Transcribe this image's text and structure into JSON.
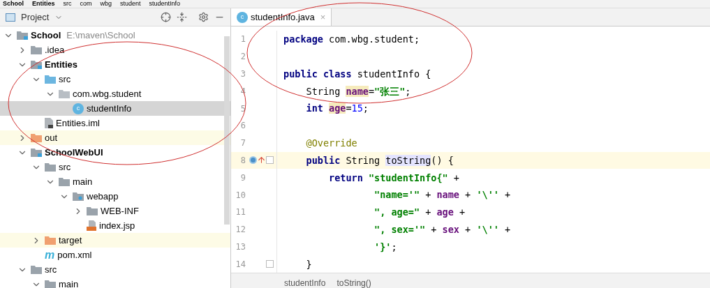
{
  "breadcrumbs": [
    "School",
    "Entities",
    "src",
    "com",
    "wbg",
    "student",
    "studentInfo"
  ],
  "project_panel": {
    "title": "Project",
    "tree": [
      {
        "label": "School",
        "path": "E:\\maven\\School",
        "kind": "module",
        "expanded": true,
        "selected": false,
        "children": [
          {
            "label": ".idea",
            "kind": "folder",
            "expanded": false,
            "selected": false
          },
          {
            "label": "Entities",
            "kind": "module",
            "expanded": true,
            "selected": false,
            "children": [
              {
                "label": "src",
                "kind": "source",
                "expanded": true,
                "selected": false,
                "children": [
                  {
                    "label": "com.wbg.student",
                    "kind": "package",
                    "expanded": true,
                    "selected": false,
                    "children": [
                      {
                        "label": "studentInfo",
                        "kind": "class",
                        "icon": "c",
                        "selected": true
                      }
                    ]
                  }
                ]
              },
              {
                "label": "Entities.iml",
                "kind": "iml",
                "selected": false
              }
            ]
          },
          {
            "label": "out",
            "kind": "excluded",
            "expanded": false,
            "selected": false
          },
          {
            "label": "SchoolWebUI",
            "kind": "module",
            "expanded": true,
            "selected": false,
            "children": [
              {
                "label": "src",
                "kind": "folder",
                "expanded": true,
                "selected": false,
                "children": [
                  {
                    "label": "main",
                    "kind": "folder",
                    "expanded": true,
                    "selected": false,
                    "children": [
                      {
                        "label": "webapp",
                        "kind": "web",
                        "expanded": true,
                        "selected": false,
                        "children": [
                          {
                            "label": "WEB-INF",
                            "kind": "folder",
                            "expanded": false,
                            "selected": false
                          },
                          {
                            "label": "index.jsp",
                            "kind": "jsp",
                            "selected": false
                          }
                        ]
                      }
                    ]
                  }
                ]
              },
              {
                "label": "target",
                "kind": "excluded",
                "expanded": false,
                "selected": false
              },
              {
                "label": "pom.xml",
                "kind": "maven",
                "icon": "m",
                "selected": false
              }
            ]
          },
          {
            "label": "src",
            "kind": "folder",
            "expanded": true,
            "selected": false,
            "children": [
              {
                "label": "main",
                "kind": "folder",
                "expanded": true,
                "selected": false
              }
            ]
          }
        ]
      }
    ]
  },
  "editor": {
    "tabs": [
      {
        "label": "studentInfo.java",
        "icon": "c",
        "close": "×",
        "selected": true
      }
    ],
    "lines": [
      {
        "number": "1",
        "tokens": [
          {
            "kind": "keyword",
            "text": "package"
          },
          {
            "kind": "plain",
            "text": " com.wbg.student;"
          }
        ]
      },
      {
        "number": "2"
      },
      {
        "number": "3",
        "tokens": [
          {
            "kind": "keyword",
            "text": "public class"
          },
          {
            "kind": "plain",
            "text": " studentInfo {"
          }
        ]
      },
      {
        "number": "4",
        "tokens": [
          {
            "kind": "plain",
            "text": "    String "
          },
          {
            "kind": "field",
            "text": "name",
            "marked": true
          },
          {
            "kind": "plain",
            "text": "="
          },
          {
            "kind": "string",
            "text": "\"张三\""
          },
          {
            "kind": "plain",
            "text": ";"
          }
        ]
      },
      {
        "number": "5",
        "tokens": [
          {
            "kind": "keyword",
            "text": "    int "
          },
          {
            "kind": "field",
            "text": "age",
            "marked": true
          },
          {
            "kind": "plain",
            "text": "="
          },
          {
            "kind": "number",
            "text": "15"
          },
          {
            "kind": "plain",
            "text": ";"
          }
        ]
      },
      {
        "number": "6"
      },
      {
        "number": "7",
        "tokens": [
          {
            "kind": "annotation",
            "text": "    @Override"
          }
        ]
      },
      {
        "number": "8",
        "current": true,
        "override": true,
        "fold": true,
        "tokens": [
          {
            "kind": "keyword",
            "text": "    public "
          },
          {
            "kind": "plain",
            "text": "String "
          },
          {
            "kind": "plain",
            "text": "toString",
            "marked": true
          },
          {
            "kind": "plain",
            "text": "() {"
          }
        ]
      },
      {
        "number": "9",
        "tokens": [
          {
            "kind": "keyword",
            "text": "        return "
          },
          {
            "kind": "string",
            "text": "\"studentInfo{\""
          },
          {
            "kind": "plain",
            "text": " +"
          }
        ]
      },
      {
        "number": "10",
        "tokens": [
          {
            "kind": "string",
            "text": "                \"name='\""
          },
          {
            "kind": "plain",
            "text": " + "
          },
          {
            "kind": "field",
            "text": "name"
          },
          {
            "kind": "plain",
            "text": " + "
          },
          {
            "kind": "string",
            "text": "'\\''"
          },
          {
            "kind": "plain",
            "text": " +"
          }
        ]
      },
      {
        "number": "11",
        "tokens": [
          {
            "kind": "string",
            "text": "                \", age=\""
          },
          {
            "kind": "plain",
            "text": " + "
          },
          {
            "kind": "field",
            "text": "age"
          },
          {
            "kind": "plain",
            "text": " +"
          }
        ]
      },
      {
        "number": "12",
        "tokens": [
          {
            "kind": "string",
            "text": "                \", sex='\""
          },
          {
            "kind": "plain",
            "text": " + "
          },
          {
            "kind": "field",
            "text": "sex"
          },
          {
            "kind": "plain",
            "text": " + "
          },
          {
            "kind": "string",
            "text": "'\\''"
          },
          {
            "kind": "plain",
            "text": " +"
          }
        ]
      },
      {
        "number": "13",
        "tokens": [
          {
            "kind": "string",
            "text": "                '}'"
          },
          {
            "kind": "plain",
            "text": ";"
          }
        ]
      },
      {
        "number": "14",
        "fold": true,
        "tokens": [
          {
            "kind": "plain",
            "text": "    }"
          }
        ]
      }
    ],
    "status_breadcrumbs": [
      "studentInfo",
      "toString()"
    ]
  }
}
